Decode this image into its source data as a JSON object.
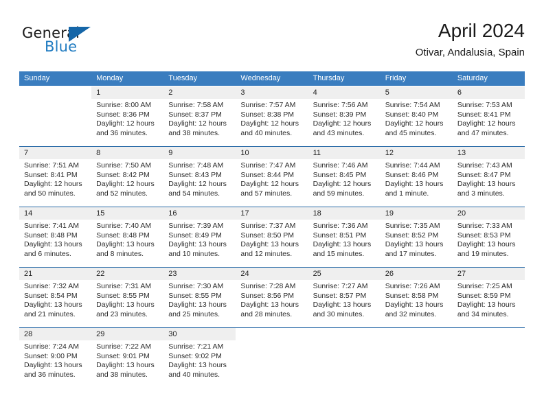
{
  "brand": {
    "name_top": "General",
    "name_bottom": "Blue",
    "accent_color": "#1f7bc1",
    "triangle_color": "#1566a8"
  },
  "header": {
    "title": "April 2024",
    "subtitle": "Otivar, Andalusia, Spain"
  },
  "calendar": {
    "header_bg": "#3a7dbf",
    "row_divider_color": "#2a6ba8",
    "daynum_bg": "#efefef",
    "weekdays": [
      "Sunday",
      "Monday",
      "Tuesday",
      "Wednesday",
      "Thursday",
      "Friday",
      "Saturday"
    ],
    "weeks": [
      [
        {
          "day": "",
          "lines": []
        },
        {
          "day": "1",
          "lines": [
            "Sunrise: 8:00 AM",
            "Sunset: 8:36 PM",
            "Daylight: 12 hours",
            "and 36 minutes."
          ]
        },
        {
          "day": "2",
          "lines": [
            "Sunrise: 7:58 AM",
            "Sunset: 8:37 PM",
            "Daylight: 12 hours",
            "and 38 minutes."
          ]
        },
        {
          "day": "3",
          "lines": [
            "Sunrise: 7:57 AM",
            "Sunset: 8:38 PM",
            "Daylight: 12 hours",
            "and 40 minutes."
          ]
        },
        {
          "day": "4",
          "lines": [
            "Sunrise: 7:56 AM",
            "Sunset: 8:39 PM",
            "Daylight: 12 hours",
            "and 43 minutes."
          ]
        },
        {
          "day": "5",
          "lines": [
            "Sunrise: 7:54 AM",
            "Sunset: 8:40 PM",
            "Daylight: 12 hours",
            "and 45 minutes."
          ]
        },
        {
          "day": "6",
          "lines": [
            "Sunrise: 7:53 AM",
            "Sunset: 8:41 PM",
            "Daylight: 12 hours",
            "and 47 minutes."
          ]
        }
      ],
      [
        {
          "day": "7",
          "lines": [
            "Sunrise: 7:51 AM",
            "Sunset: 8:41 PM",
            "Daylight: 12 hours",
            "and 50 minutes."
          ]
        },
        {
          "day": "8",
          "lines": [
            "Sunrise: 7:50 AM",
            "Sunset: 8:42 PM",
            "Daylight: 12 hours",
            "and 52 minutes."
          ]
        },
        {
          "day": "9",
          "lines": [
            "Sunrise: 7:48 AM",
            "Sunset: 8:43 PM",
            "Daylight: 12 hours",
            "and 54 minutes."
          ]
        },
        {
          "day": "10",
          "lines": [
            "Sunrise: 7:47 AM",
            "Sunset: 8:44 PM",
            "Daylight: 12 hours",
            "and 57 minutes."
          ]
        },
        {
          "day": "11",
          "lines": [
            "Sunrise: 7:46 AM",
            "Sunset: 8:45 PM",
            "Daylight: 12 hours",
            "and 59 minutes."
          ]
        },
        {
          "day": "12",
          "lines": [
            "Sunrise: 7:44 AM",
            "Sunset: 8:46 PM",
            "Daylight: 13 hours",
            "and 1 minute."
          ]
        },
        {
          "day": "13",
          "lines": [
            "Sunrise: 7:43 AM",
            "Sunset: 8:47 PM",
            "Daylight: 13 hours",
            "and 3 minutes."
          ]
        }
      ],
      [
        {
          "day": "14",
          "lines": [
            "Sunrise: 7:41 AM",
            "Sunset: 8:48 PM",
            "Daylight: 13 hours",
            "and 6 minutes."
          ]
        },
        {
          "day": "15",
          "lines": [
            "Sunrise: 7:40 AM",
            "Sunset: 8:48 PM",
            "Daylight: 13 hours",
            "and 8 minutes."
          ]
        },
        {
          "day": "16",
          "lines": [
            "Sunrise: 7:39 AM",
            "Sunset: 8:49 PM",
            "Daylight: 13 hours",
            "and 10 minutes."
          ]
        },
        {
          "day": "17",
          "lines": [
            "Sunrise: 7:37 AM",
            "Sunset: 8:50 PM",
            "Daylight: 13 hours",
            "and 12 minutes."
          ]
        },
        {
          "day": "18",
          "lines": [
            "Sunrise: 7:36 AM",
            "Sunset: 8:51 PM",
            "Daylight: 13 hours",
            "and 15 minutes."
          ]
        },
        {
          "day": "19",
          "lines": [
            "Sunrise: 7:35 AM",
            "Sunset: 8:52 PM",
            "Daylight: 13 hours",
            "and 17 minutes."
          ]
        },
        {
          "day": "20",
          "lines": [
            "Sunrise: 7:33 AM",
            "Sunset: 8:53 PM",
            "Daylight: 13 hours",
            "and 19 minutes."
          ]
        }
      ],
      [
        {
          "day": "21",
          "lines": [
            "Sunrise: 7:32 AM",
            "Sunset: 8:54 PM",
            "Daylight: 13 hours",
            "and 21 minutes."
          ]
        },
        {
          "day": "22",
          "lines": [
            "Sunrise: 7:31 AM",
            "Sunset: 8:55 PM",
            "Daylight: 13 hours",
            "and 23 minutes."
          ]
        },
        {
          "day": "23",
          "lines": [
            "Sunrise: 7:30 AM",
            "Sunset: 8:55 PM",
            "Daylight: 13 hours",
            "and 25 minutes."
          ]
        },
        {
          "day": "24",
          "lines": [
            "Sunrise: 7:28 AM",
            "Sunset: 8:56 PM",
            "Daylight: 13 hours",
            "and 28 minutes."
          ]
        },
        {
          "day": "25",
          "lines": [
            "Sunrise: 7:27 AM",
            "Sunset: 8:57 PM",
            "Daylight: 13 hours",
            "and 30 minutes."
          ]
        },
        {
          "day": "26",
          "lines": [
            "Sunrise: 7:26 AM",
            "Sunset: 8:58 PM",
            "Daylight: 13 hours",
            "and 32 minutes."
          ]
        },
        {
          "day": "27",
          "lines": [
            "Sunrise: 7:25 AM",
            "Sunset: 8:59 PM",
            "Daylight: 13 hours",
            "and 34 minutes."
          ]
        }
      ],
      [
        {
          "day": "28",
          "lines": [
            "Sunrise: 7:24 AM",
            "Sunset: 9:00 PM",
            "Daylight: 13 hours",
            "and 36 minutes."
          ]
        },
        {
          "day": "29",
          "lines": [
            "Sunrise: 7:22 AM",
            "Sunset: 9:01 PM",
            "Daylight: 13 hours",
            "and 38 minutes."
          ]
        },
        {
          "day": "30",
          "lines": [
            "Sunrise: 7:21 AM",
            "Sunset: 9:02 PM",
            "Daylight: 13 hours",
            "and 40 minutes."
          ]
        },
        {
          "day": "",
          "lines": []
        },
        {
          "day": "",
          "lines": []
        },
        {
          "day": "",
          "lines": []
        },
        {
          "day": "",
          "lines": []
        }
      ]
    ]
  }
}
